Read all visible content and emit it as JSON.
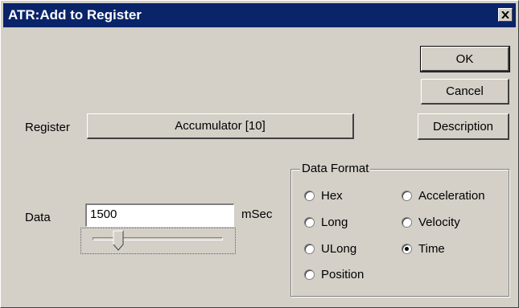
{
  "window": {
    "title": "ATR:Add to Register"
  },
  "buttons": {
    "ok": "OK",
    "cancel": "Cancel",
    "description": "Description"
  },
  "register": {
    "label": "Register",
    "value": "Accumulator [10]"
  },
  "data": {
    "label": "Data",
    "value": "1500",
    "unit": "mSec",
    "slider_level_fraction": 0.2
  },
  "data_format": {
    "title": "Data Format",
    "options": [
      "Hex",
      "Long",
      "ULong",
      "Position",
      "Acceleration",
      "Velocity",
      "Time"
    ],
    "selected": "Time"
  },
  "icons": {
    "close": "close-icon"
  }
}
